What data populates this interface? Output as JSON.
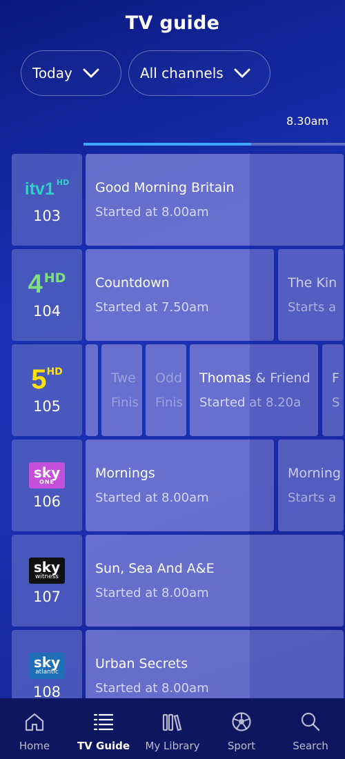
{
  "header": {
    "title": "TV guide"
  },
  "filters": {
    "day": "Today",
    "channels": "All channels"
  },
  "timeline": {
    "now_label": "8.30am",
    "progress": 0.64
  },
  "channels": [
    {
      "logo": "itv1 HD",
      "number": "103",
      "programs": [
        {
          "title": "Good Morning Britain",
          "sub": "Started at 8.00am"
        }
      ]
    },
    {
      "logo": "4 HD",
      "number": "104",
      "programs": [
        {
          "title": "Countdown",
          "sub": "Started at 7.50am"
        },
        {
          "title": "The Kin",
          "sub": "Starts a"
        }
      ]
    },
    {
      "logo": "5 HD",
      "number": "105",
      "programs": [
        {
          "title": "Twe",
          "sub": "Finis"
        },
        {
          "title": "Odd",
          "sub": "Finis"
        },
        {
          "title": "Thomas & Friend",
          "sub": "Started at 8.20a"
        },
        {
          "title": "F",
          "sub": "S"
        }
      ]
    },
    {
      "logo": "sky ONE",
      "number": "106",
      "programs": [
        {
          "title": "Mornings",
          "sub": "Started at 8.00am"
        },
        {
          "title": "Morning",
          "sub": "Starts a"
        }
      ]
    },
    {
      "logo": "sky witness",
      "number": "107",
      "programs": [
        {
          "title": "Sun, Sea And A&E",
          "sub": "Started at 8.00am"
        }
      ]
    },
    {
      "logo": "sky atlantic",
      "number": "108",
      "programs": [
        {
          "title": "Urban Secrets",
          "sub": "Started at 8.00am"
        }
      ]
    }
  ],
  "nav": [
    {
      "label": "Home",
      "icon": "home-icon"
    },
    {
      "label": "TV Guide",
      "icon": "tv-guide-icon"
    },
    {
      "label": "My Library",
      "icon": "library-icon"
    },
    {
      "label": "Sport",
      "icon": "sport-icon"
    },
    {
      "label": "Search",
      "icon": "search-icon"
    }
  ],
  "colors": {
    "accent": "#3aa6ff",
    "itv": "#2fd0c8",
    "ch4": "#7ee07a",
    "ch5": "#ffe000",
    "sky_one": "#c44fdb"
  }
}
